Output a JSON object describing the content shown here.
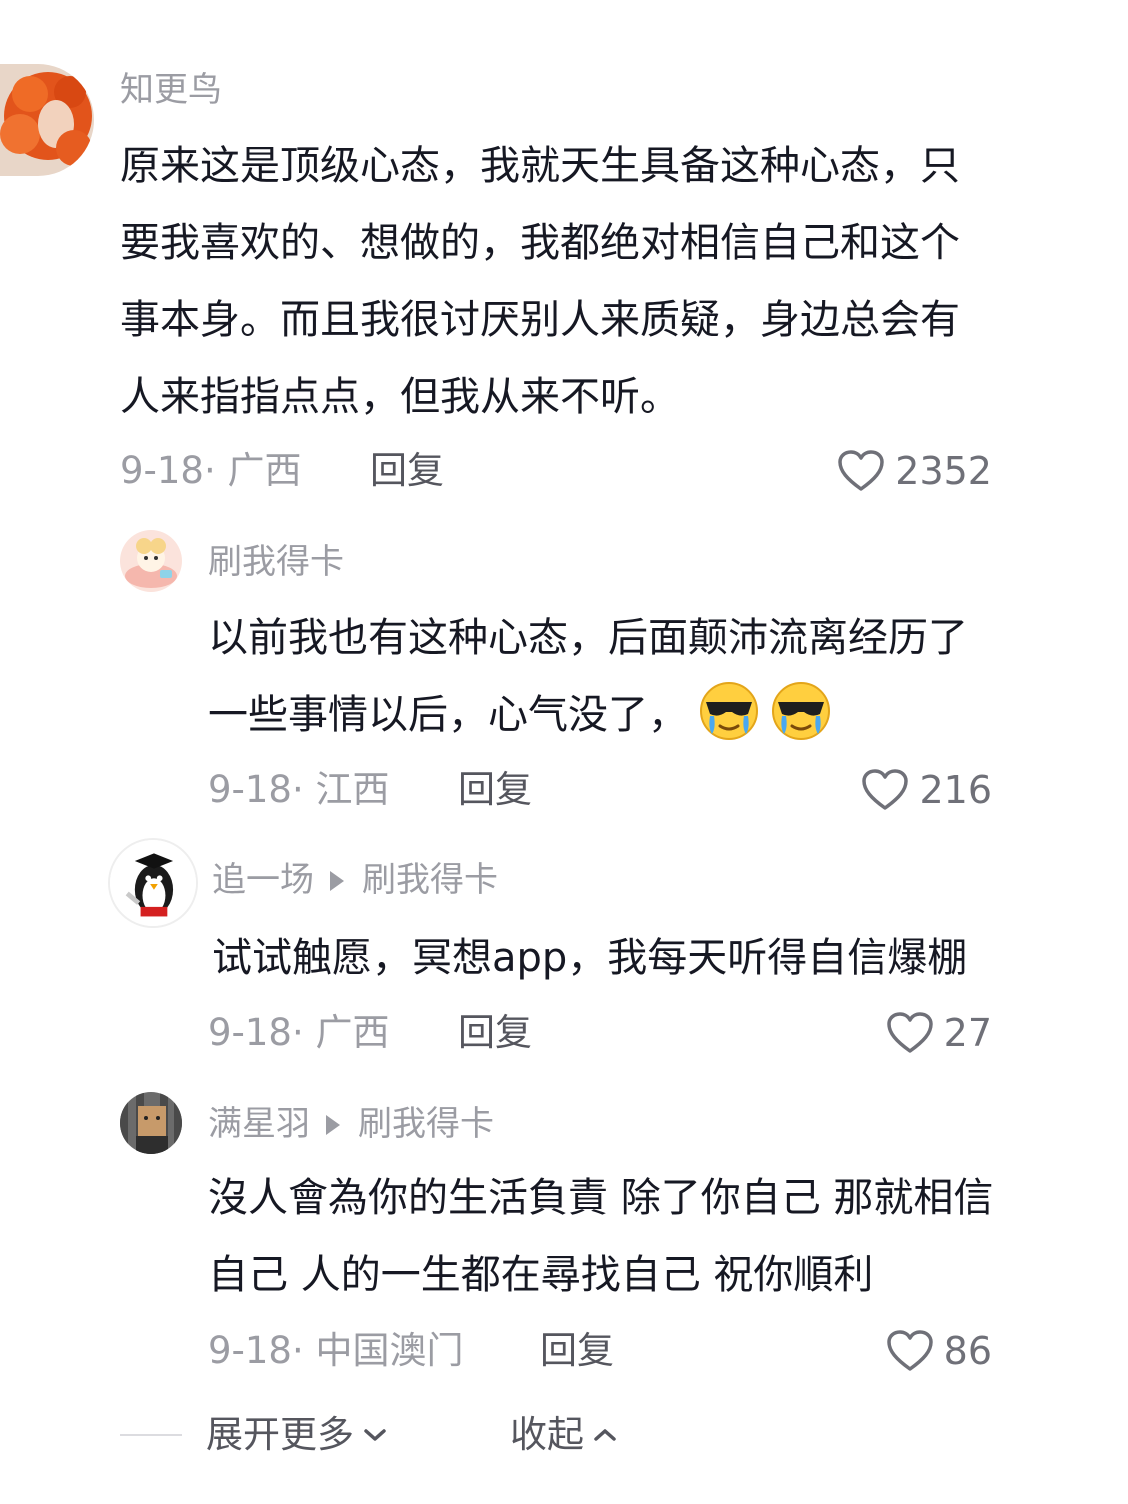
{
  "comments": [
    {
      "username": "知更鸟",
      "lines": [
        "原来这是顶级心态，我就天生具备这种心态，只",
        "要我喜欢的、想做的，我都绝对相信自己和这个",
        "事本身。而且我很讨厌别人来质疑，身边总会有",
        "人来指指点点，但我从来不听。"
      ],
      "meta": "9-18· 广西",
      "reply_label": "回复",
      "likes": "2352"
    },
    {
      "username": "刷我得卡",
      "lines": [
        "以前我也有这种心态，后面颠沛流离经历了",
        "一些事情以后，心气没了，"
      ],
      "emojis": [
        "cool-crying-emoji",
        "cool-crying-emoji"
      ],
      "meta": "9-18· 江西",
      "reply_label": "回复",
      "likes": "216"
    },
    {
      "username": "追一场",
      "reply_to": "刷我得卡",
      "lines": [
        "试试触愿，冥想app，我每天听得自信爆棚"
      ],
      "meta": "9-18· 广西",
      "reply_label": "回复",
      "likes": "27"
    },
    {
      "username": "满星羽",
      "reply_to": "刷我得卡",
      "lines": [
        "沒人會為你的生活負責 除了你自己 那就相信",
        "自己 人的一生都在尋找自己 祝你順利"
      ],
      "meta": "9-18· 中国澳门",
      "reply_label": "回复",
      "likes": "86"
    }
  ],
  "footer": {
    "expand_label": "展开更多",
    "collapse_label": "收起"
  },
  "colors": {
    "muted_text": "#9b9ca3",
    "body_text": "#161823",
    "action_text": "#55565e"
  }
}
